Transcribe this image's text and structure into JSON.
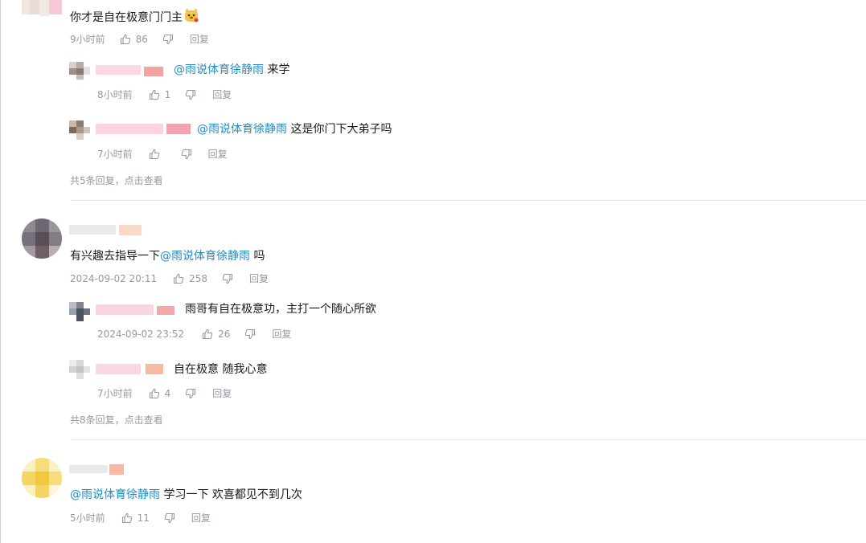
{
  "comments": [
    {
      "text": "你才是自在极意门门主",
      "emoji": "dog-emoji",
      "time": "9小时前",
      "likes": "86",
      "reply_label": "回复",
      "replies": [
        {
          "mention": "@雨说体育徐静雨",
          "text": " 来学",
          "time": "8小时前",
          "likes": "1",
          "reply_label": "回复"
        },
        {
          "mention": "@雨说体育徐静雨",
          "text": " 这是你门下大弟子吗",
          "time": "7小时前",
          "likes": "",
          "reply_label": "回复"
        }
      ],
      "more_replies": "共5条回复，点击查看"
    },
    {
      "text_before": "有兴趣去指导一下",
      "mention": "@雨说体育徐静雨",
      "text_after": " 吗",
      "time": "2024-09-02 20:11",
      "likes": "258",
      "reply_label": "回复",
      "replies": [
        {
          "text": "雨哥有自在极意功，主打一个随心所欲",
          "time": "2024-09-02 23:52",
          "likes": "26",
          "reply_label": "回复"
        },
        {
          "text": "自在极意 随我心意",
          "time": "7小时前",
          "likes": "4",
          "reply_label": "回复"
        }
      ],
      "more_replies": "共8条回复，点击查看"
    },
    {
      "mention": "@雨说体育徐静雨",
      "text_after": " 学习一下 欢喜都见不到几次",
      "time": "5小时前",
      "likes": "11",
      "reply_label": "回复"
    }
  ]
}
